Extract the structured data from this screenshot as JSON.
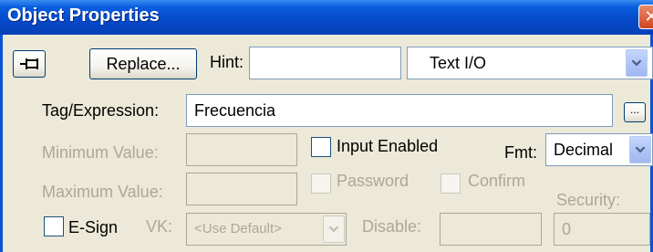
{
  "window": {
    "title": "Object Properties"
  },
  "toolbar": {
    "pin_icon": "pushpin-icon",
    "replace_label": "Replace...",
    "hint_label": "Hint:",
    "hint_value": "",
    "object_type": "Text I/O"
  },
  "tag": {
    "label": "Tag/Expression:",
    "value": "Frecuencia",
    "browse_label": "..."
  },
  "limits": {
    "min_label": "Minimum Value:",
    "min_value": "",
    "max_label": "Maximum Value:",
    "max_value": ""
  },
  "options": {
    "input_enabled": "Input Enabled",
    "password": "Password",
    "confirm": "Confirm"
  },
  "format": {
    "label": "Fmt:",
    "value": "Decimal"
  },
  "security": {
    "label": "Security:",
    "value": "0"
  },
  "bottom": {
    "esign_label": "E-Sign",
    "vk_label": "VK:",
    "vk_value": "<Use Default>",
    "disable_label": "Disable:",
    "disable_value": ""
  }
}
